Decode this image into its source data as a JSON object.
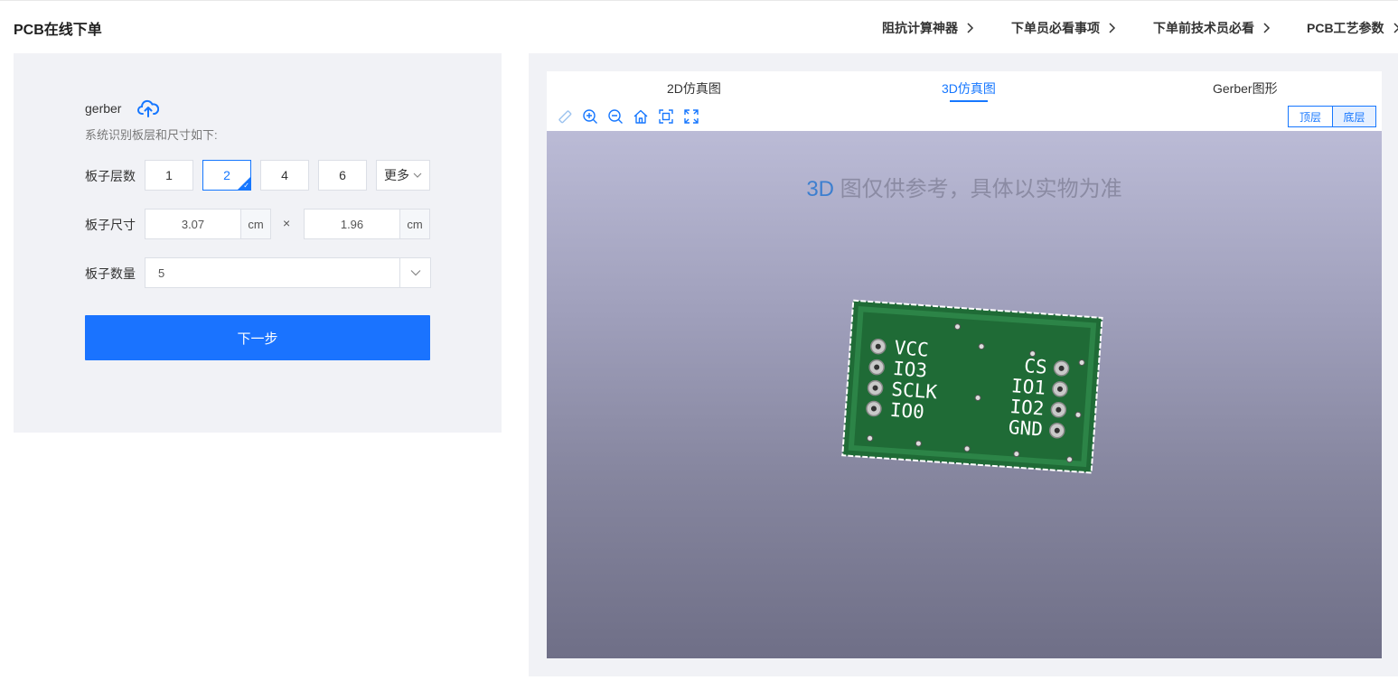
{
  "header": {
    "title": "PCB在线下单",
    "nav": [
      {
        "label": "阻抗计算神器"
      },
      {
        "label": "下单员必看事项"
      },
      {
        "label": "下单前技术员必看"
      },
      {
        "label": "PCB工艺参数"
      }
    ]
  },
  "left": {
    "gerber_label": "gerber",
    "upload_icon": "cloud-upload-icon",
    "sys_text": "系统识别板层和尺寸如下:",
    "layers": {
      "label": "板子层数",
      "options": [
        "1",
        "2",
        "4",
        "6"
      ],
      "selected": "2",
      "more_label": "更多"
    },
    "size": {
      "label": "板子尺寸",
      "width": "3.07",
      "height": "1.96",
      "unit": "cm",
      "times": "×"
    },
    "quantity": {
      "label": "板子数量",
      "value": "5"
    },
    "next_button": "下一步"
  },
  "viewer": {
    "tabs": [
      {
        "label": "2D仿真图"
      },
      {
        "label": "3D仿真图"
      },
      {
        "label": "Gerber图形"
      }
    ],
    "active_tab": "3D仿真图",
    "tools": [
      "ruler-icon",
      "zoom-in-icon",
      "zoom-out-icon",
      "home-icon",
      "fit-icon",
      "fullscreen-icon"
    ],
    "layer_buttons": {
      "top": "顶层",
      "bottom": "底层",
      "active": "底层"
    },
    "note_highlight": "3D",
    "note_rest": " 图仅供参考，具体以实物为准",
    "pcb_labels_left": [
      "VCC",
      "IO3",
      "SCLK",
      "IO0"
    ],
    "pcb_labels_right": [
      "CS",
      "IO1",
      "IO2",
      "GND"
    ],
    "colors": {
      "board": "#1f6b36",
      "board_edge": "#ffffff",
      "canvas_top": "#bbbbd6",
      "canvas_bottom": "#6f6f87",
      "accent": "#1677ff"
    }
  }
}
